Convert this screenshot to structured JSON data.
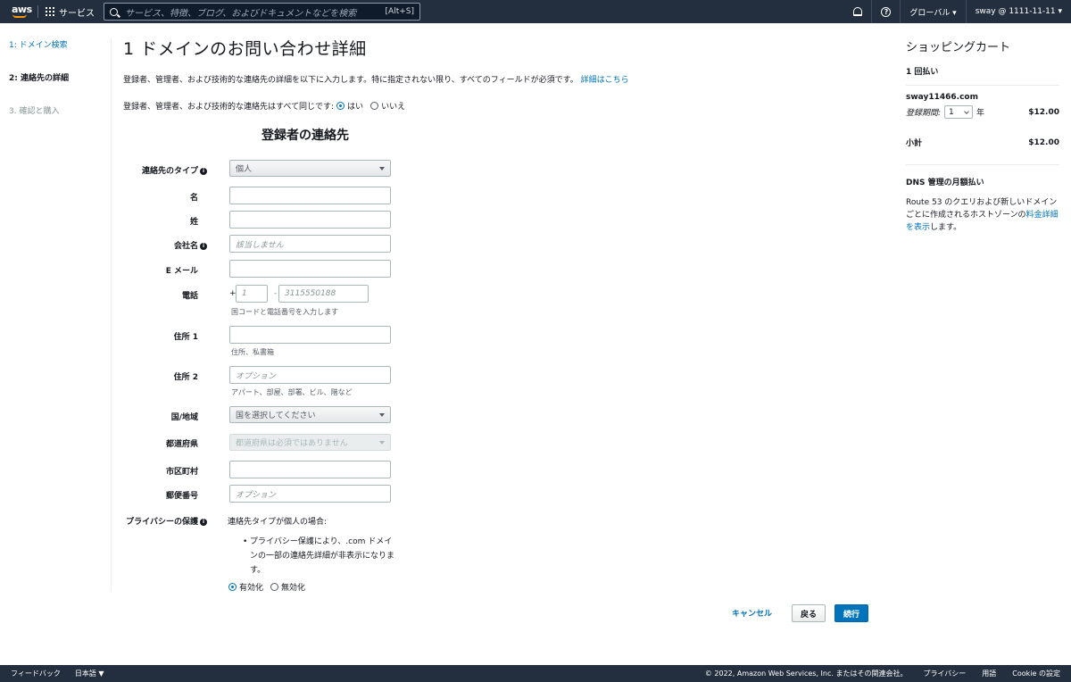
{
  "topnav": {
    "logo": "aws",
    "services_label": "サービス",
    "search_placeholder": "サービス、特徴、ブログ、およびドキュメントなどを検索",
    "search_shortcut": "[Alt+S]",
    "region_label": "グローバル ▾",
    "account_label": "sway @ 1111-11-11 ▾",
    "help_icon": "?"
  },
  "steps": [
    {
      "label": "1: ドメイン検索"
    },
    {
      "label": "2: 連絡先の詳細"
    },
    {
      "label": "3. 確認と購入"
    }
  ],
  "main": {
    "title": "1 ドメインのお問い合わせ詳細",
    "description": "登録者、管理者、および技術的な連絡先の詳細を以下に入力します。特に指定されない限り、すべてのフィールドが必須です。",
    "details_link": "詳細はこちら",
    "same_contacts_label": "登録者、管理者、および技術的な連絡先はすべて同じです:",
    "yes_label": "はい",
    "no_label": "いいえ",
    "section_title": "登録者の連絡先"
  },
  "form": {
    "contact_type_label": "連絡先のタイプ",
    "contact_type_value": "個人",
    "first_name_label": "名",
    "last_name_label": "姓",
    "company_label": "会社名",
    "company_placeholder": "該当しません",
    "email_label": "E メール",
    "phone_label": "電話",
    "phone_plus": "+",
    "phone_country_placeholder": "1",
    "phone_dash": "-",
    "phone_number_placeholder": "3115550188",
    "phone_hint": "国コードと電話番号を入力します",
    "address1_label": "住所 1",
    "address1_hint": "住所、私書箱",
    "address2_label": "住所 2",
    "address2_placeholder": "オプション",
    "address2_hint": "アパート、部屋、部署、ビル、階など",
    "country_label": "国/地域",
    "country_placeholder": "国を選択してください",
    "state_label": "都道府県",
    "state_placeholder": "都道府県は必須ではありません",
    "city_label": "市区町村",
    "zip_label": "郵便番号",
    "zip_placeholder": "オプション",
    "privacy_label": "プライバシーの保護",
    "privacy_text": "連絡先タイプが個人の場合:",
    "privacy_bullet": "プライバシー保護により、.com ドメインの一部の連絡先詳細が非表示になります。",
    "enable_label": "有効化",
    "disable_label": "無効化",
    "info_icon": "i"
  },
  "actions": {
    "cancel": "キャンセル",
    "back": "戻る",
    "next": "続行"
  },
  "cart": {
    "title": "ショッピングカート",
    "one_time": "1 回払い",
    "domain": "sway11466.com",
    "period_label": "登録期間:",
    "period_value": "1",
    "period_unit": "年",
    "domain_price": "$12.00",
    "subtotal_label": "小計",
    "subtotal_price": "$12.00",
    "dns_heading": "DNS 管理の月額払い",
    "dns_text": "Route 53 のクエリおよび新しいドメインごとに作成されるホストゾーンの",
    "dns_link": "料金詳細を表示",
    "dns_text_end": "します。"
  },
  "footer": {
    "feedback": "フィードバック",
    "language": "日本語 ▼",
    "copyright": "© 2022, Amazon Web Services, Inc. またはその関連会社。",
    "privacy": "プライバシー",
    "terms": "用語",
    "cookie": "Cookie の設定"
  },
  "colors": {
    "nav_bg": "#232f3e",
    "link": "#0073bb",
    "primary_button": "#0073bb",
    "logo_smile": "#ff9900"
  }
}
